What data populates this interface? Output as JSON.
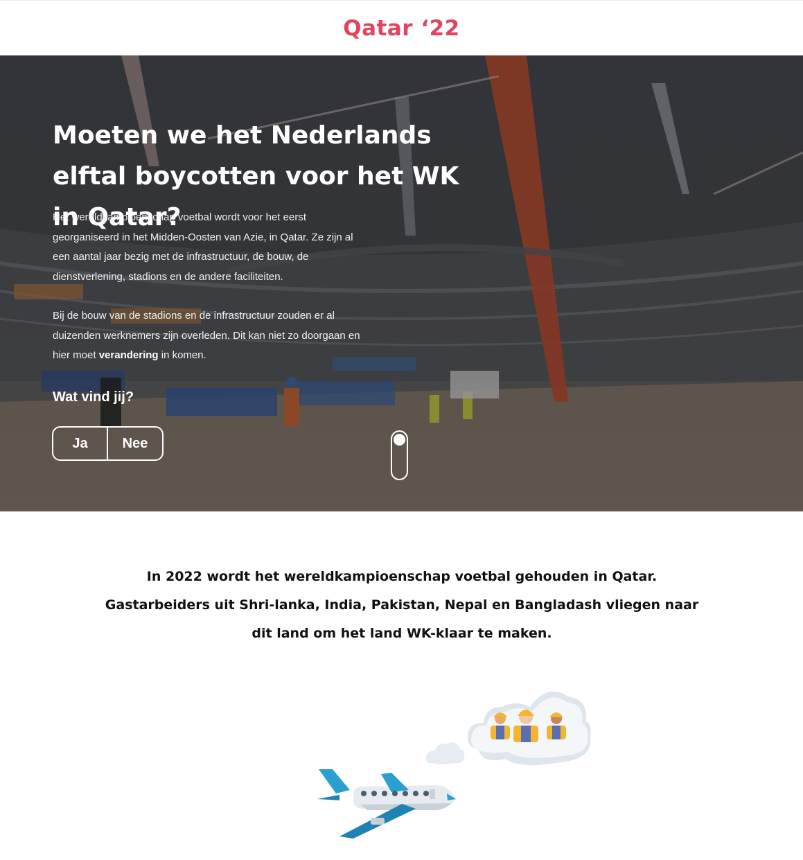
{
  "header": {
    "logo": "Qatar ‘22"
  },
  "hero": {
    "headline": "Moeten we het Nederlands elftal boycotten voor het WK in Qatar?",
    "paragraph1": "Het wereldkampioenschap voetbal wordt voor het eerst georganiseerd in het Midden-Oosten van Azie, in Qatar. Ze zijn al een aantal jaar bezig met de infrastructuur, de bouw, de dienstverlening, stadions en de andere faciliteiten.",
    "paragraph2_before": "Bij de bouw van de stadions en de infrastructuur zouden er al duizenden werknemers zijn overleden. Dit kan niet zo doorgaan en hier moet ",
    "paragraph2_bold": "verandering",
    "paragraph2_after": " in komen.",
    "question": "Wat vind jij?",
    "vote": {
      "yes_label": "Ja",
      "no_label": "Nee"
    }
  },
  "story": {
    "text": "In 2022 wordt het wereldkampioenschap voetbal gehouden in Qatar. Gastarbeiders uit Shri-lanka, India, Pakistan, Nepal en Bangladash vliegen naar dit land om het land WK-klaar te maken."
  },
  "colors": {
    "brand": "#e0445f",
    "plane_blue": "#2a9fd0",
    "helmet_yellow": "#f2b632"
  },
  "icons": {
    "scroll": "scroll-indicator-icon",
    "plane": "airplane-icon",
    "workers": "workers-icon",
    "cloud": "cloud-icon"
  }
}
